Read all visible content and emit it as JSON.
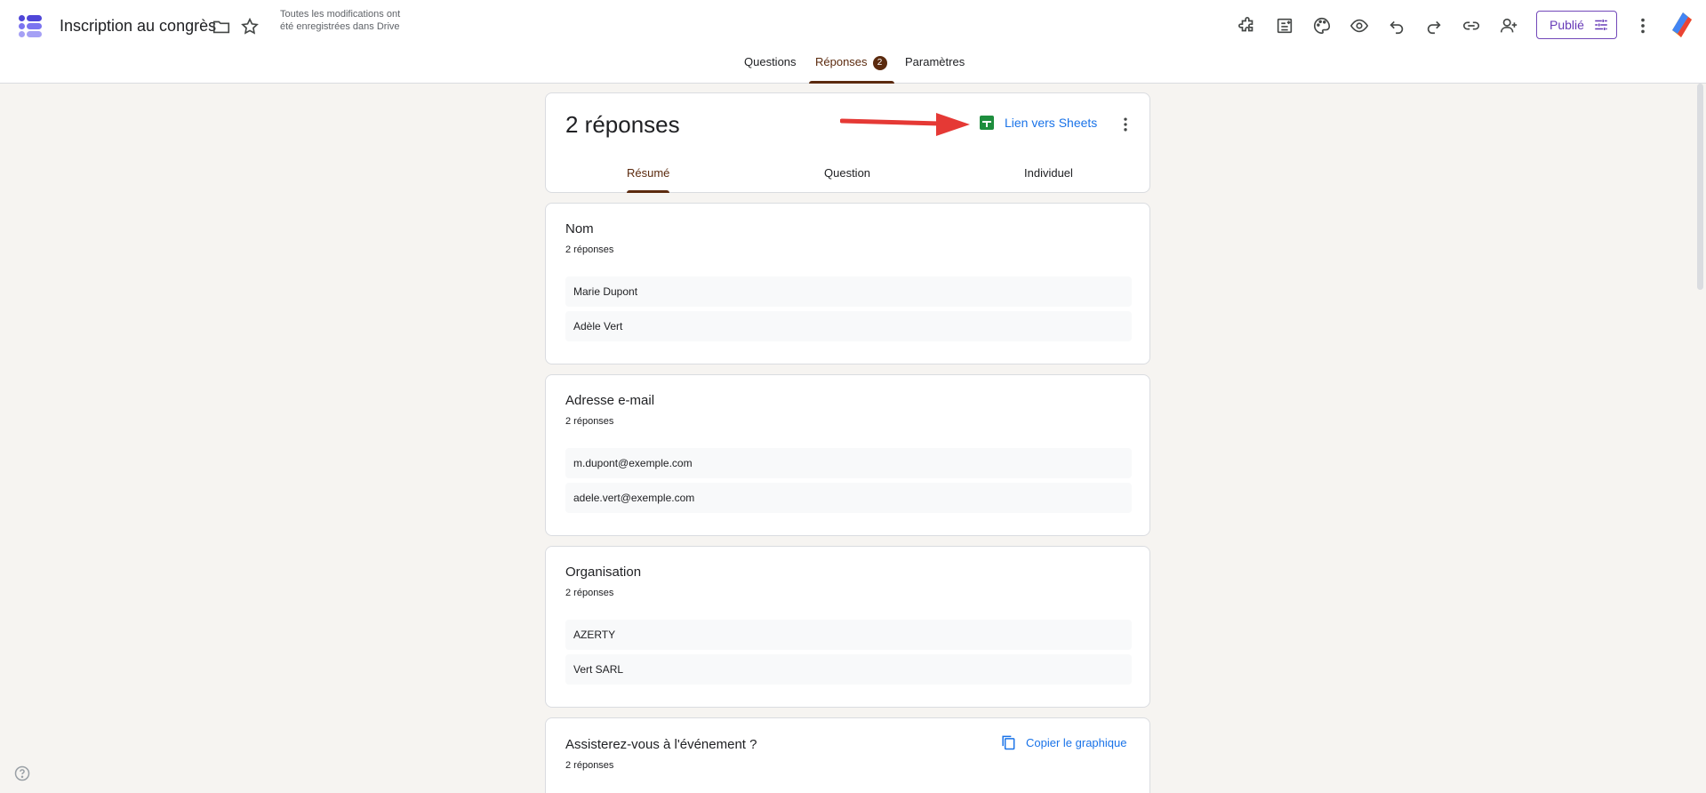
{
  "header": {
    "title": "Inscription au congrès",
    "save_status": "Toutes les modifications ont été enregistrées dans Drive",
    "publish_label": "Publié"
  },
  "tabs": {
    "questions": "Questions",
    "responses": "Réponses",
    "responses_count": "2",
    "settings": "Paramètres"
  },
  "summary": {
    "title": "2 réponses",
    "sheets_link": "Lien vers Sheets",
    "subtabs": [
      "Résumé",
      "Question",
      "Individuel"
    ]
  },
  "questions": [
    {
      "title": "Nom",
      "count": "2 réponses",
      "answers": [
        "Marie Dupont",
        "Adèle Vert"
      ]
    },
    {
      "title": "Adresse e-mail",
      "count": "2 réponses",
      "answers": [
        "m.dupont@exemple.com",
        "adele.vert@exemple.com"
      ]
    },
    {
      "title": "Organisation",
      "count": "2 réponses",
      "answers": [
        "AZERTY",
        "Vert SARL"
      ]
    },
    {
      "title": "Assisterez-vous à l'événement ?",
      "count": "2 réponses",
      "copy_label": "Copier le graphique"
    }
  ],
  "icons": {
    "toolbar": [
      "add-on-icon",
      "import-icon",
      "palette-icon",
      "preview-icon",
      "undo-icon",
      "redo-icon",
      "link-icon",
      "add-collaborator-icon"
    ],
    "accent": "#673ab7",
    "brand_brown": "#5b2a0e",
    "arrow_color": "#e53935"
  }
}
